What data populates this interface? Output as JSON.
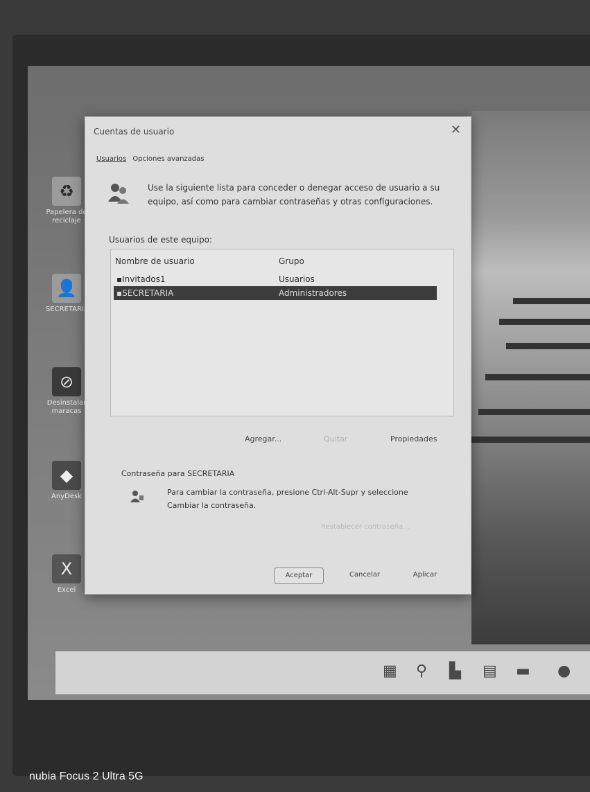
{
  "dialog": {
    "title": "Cuentas de usuario",
    "tabs": [
      {
        "label": "Usuarios"
      },
      {
        "label": "Opciones avanzadas"
      }
    ],
    "intro_text": "Use la siguiente lista para conceder o denegar acceso de usuario a su equipo, así como para cambiar contraseñas y otras configuraciones.",
    "users_section_label": "Usuarios de este equipo:",
    "columns": {
      "user": "Nombre de usuario",
      "group": "Grupo"
    },
    "rows": [
      {
        "user": "Invitados1",
        "group": "Usuarios",
        "selected": false
      },
      {
        "user": "SECRETARIA",
        "group": "Administradores",
        "selected": true
      }
    ],
    "buttons": {
      "add": "Agregar...",
      "remove": "Quitar",
      "properties": "Propiedades"
    },
    "password_section_label": "Contraseña para SECRETARIA",
    "password_text": "Para cambiar la contraseña, presione Ctrl-Alt-Supr y seleccione Cambiar la contraseña.",
    "reset_password": "Restablecer contraseña...",
    "ok": "Aceptar",
    "cancel": "Cancelar",
    "apply": "Aplicar"
  },
  "desktop": {
    "icons": [
      {
        "label": "Papelera de reciclaje",
        "icon": "recycle-bin-icon"
      },
      {
        "label": "SECRETARIA",
        "icon": "user-folder-icon"
      },
      {
        "label": "Desinstalar maracas",
        "icon": "uninstall-icon"
      },
      {
        "label": "AnyDesk",
        "icon": "anydesk-icon"
      },
      {
        "label": "Excel",
        "icon": "excel-icon"
      }
    ]
  },
  "taskbar": {
    "icons": [
      "windows-start-icon",
      "search-icon",
      "taskview-icon",
      "file-explorer-icon",
      "store-icon",
      "browser-icon"
    ]
  },
  "caption": "nubia Focus 2 Ultra 5G"
}
